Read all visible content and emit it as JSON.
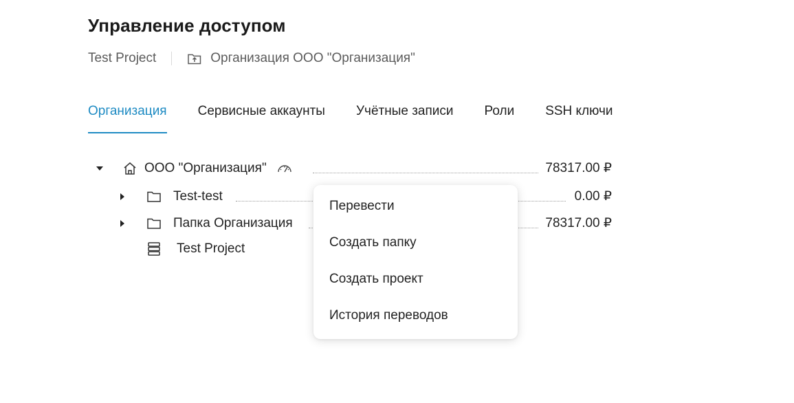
{
  "header": {
    "title": "Управление доступом",
    "breadcrumb_project": "Test Project",
    "breadcrumb_org": "Организация ООО \"Организация\""
  },
  "tabs": [
    {
      "label": "Организация",
      "active": true
    },
    {
      "label": "Сервисные аккаунты",
      "active": false
    },
    {
      "label": "Учётные записи",
      "active": false
    },
    {
      "label": "Роли",
      "active": false
    },
    {
      "label": "SSH ключи",
      "active": false
    }
  ],
  "tree": {
    "root": {
      "label": "ООО \"Организация\"",
      "amount": "78317.00 ₽",
      "icon": "home-icon",
      "badge_icon": "speedometer-icon"
    },
    "children": [
      {
        "label": "Test-test",
        "amount": "0.00 ₽",
        "icon": "folder-icon"
      },
      {
        "label": "Папка Организация",
        "amount": "78317.00 ₽",
        "icon": "folder-icon"
      },
      {
        "label": "Test Project",
        "icon": "server-stack-icon"
      }
    ]
  },
  "context_menu": {
    "items": [
      "Перевести",
      "Создать папку",
      "Создать проект",
      "История переводов"
    ]
  },
  "colors": {
    "accent": "#1e8bc3",
    "text": "#222222",
    "muted": "#5b5b5b"
  }
}
